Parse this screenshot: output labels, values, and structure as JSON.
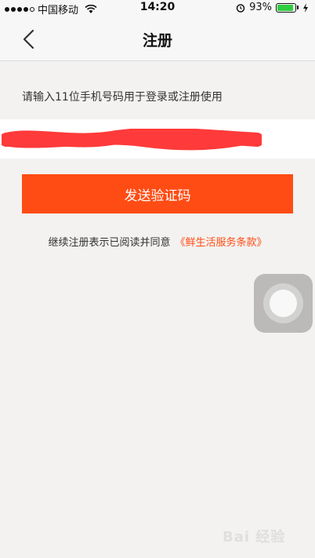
{
  "status_bar": {
    "carrier": "中国移动",
    "time": "14:20",
    "battery_level": "93%",
    "battery_fraction": 0.93,
    "battery_color": "#2ecc40"
  },
  "nav": {
    "title": "注册"
  },
  "form": {
    "hint": "请输入11位手机号码用于登录或注册使用",
    "phone_value": "",
    "send_button_label": "发送验证码"
  },
  "agreement": {
    "prefix": "继续注册表示已阅读并同意",
    "terms_link": "《鲜生活服务条款》"
  },
  "colors": {
    "accent": "#ff4c14",
    "background": "#f3f2f0",
    "redaction": "#ff3a3a"
  },
  "watermark": {
    "text": "Bai 经验"
  }
}
